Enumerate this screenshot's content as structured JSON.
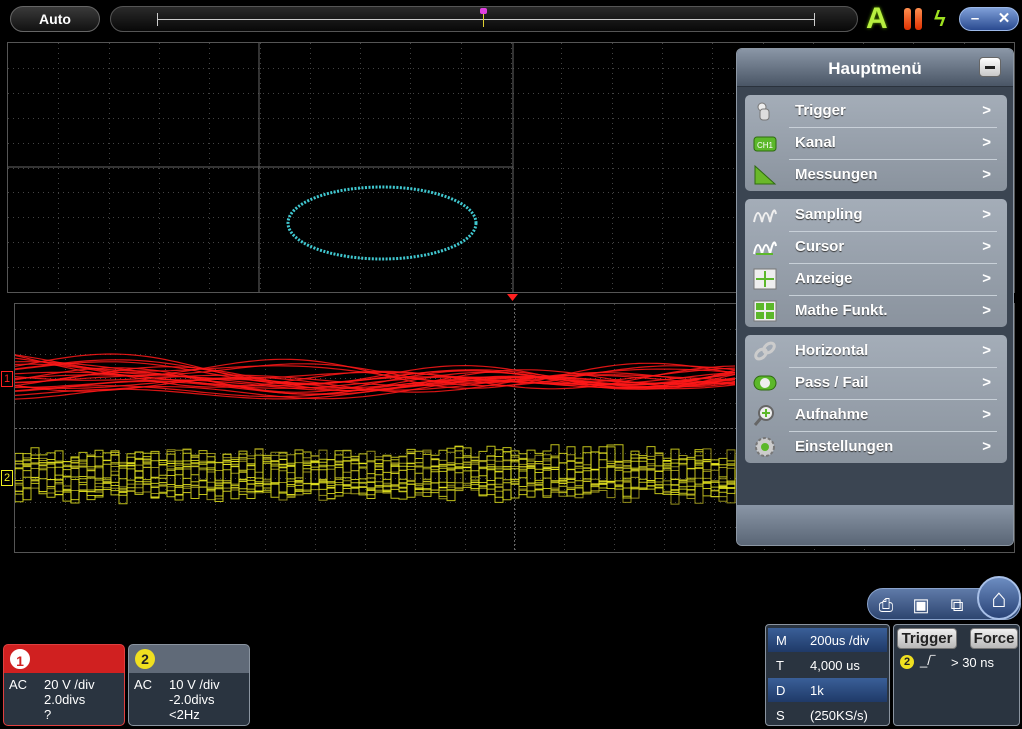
{
  "topbar": {
    "mode_label": "Auto",
    "icons": [
      "auto-scale-icon",
      "pause-icon",
      "bolt-icon"
    ],
    "window_controls": {
      "minimize": "–",
      "close": "✕"
    }
  },
  "menu": {
    "title": "Hauptmenü",
    "arrow": ">",
    "groups": [
      {
        "items": [
          {
            "label": "Trigger",
            "icon": "trigger-hand-icon"
          },
          {
            "label": "Kanal",
            "icon": "channel-ch1-icon"
          },
          {
            "label": "Messungen",
            "icon": "measure-ruler-icon"
          }
        ]
      },
      {
        "items": [
          {
            "label": "Sampling",
            "icon": "sampling-wave-icon"
          },
          {
            "label": "Cursor",
            "icon": "cursor-wave-icon"
          },
          {
            "label": "Anzeige",
            "icon": "display-crosshair-icon"
          },
          {
            "label": "Mathe Funkt.",
            "icon": "math-calc-icon"
          }
        ]
      },
      {
        "items": [
          {
            "label": "Horizontal",
            "icon": "horizontal-chain-icon"
          },
          {
            "label": "Pass / Fail",
            "icon": "pass-fail-icon"
          },
          {
            "label": "Aufnahme",
            "icon": "record-magnifier-icon"
          },
          {
            "label": "Einstellungen",
            "icon": "settings-gear-icon"
          }
        ]
      }
    ]
  },
  "channels": [
    {
      "badge": "1",
      "coupling": "AC",
      "volts_per_div": "20 V /div",
      "position": "2.0divs",
      "frequency": "?",
      "color": "#ff2020"
    },
    {
      "badge": "2",
      "coupling": "AC",
      "volts_per_div": "10 V /div",
      "position": "-2.0divs",
      "frequency": "<2Hz",
      "color": "#f0f020"
    }
  ],
  "waveform_markers": {
    "ch1": "1",
    "ch2": "2"
  },
  "timebase": [
    {
      "key": "M",
      "value": "200us /div"
    },
    {
      "key": "T",
      "value": "4,000 us"
    },
    {
      "key": "D",
      "value": "1k"
    },
    {
      "key": "S",
      "value": "(250KS/s)"
    }
  ],
  "trigger": {
    "button_label": "Trigger",
    "force_label": "Force",
    "source": "2",
    "edge": "_/‾",
    "condition": "> 30 ns"
  },
  "xy_trace_color": "#40c8d0",
  "quick_icons": [
    "print-icon",
    "save-icon",
    "layout-icon",
    "home-icon"
  ]
}
